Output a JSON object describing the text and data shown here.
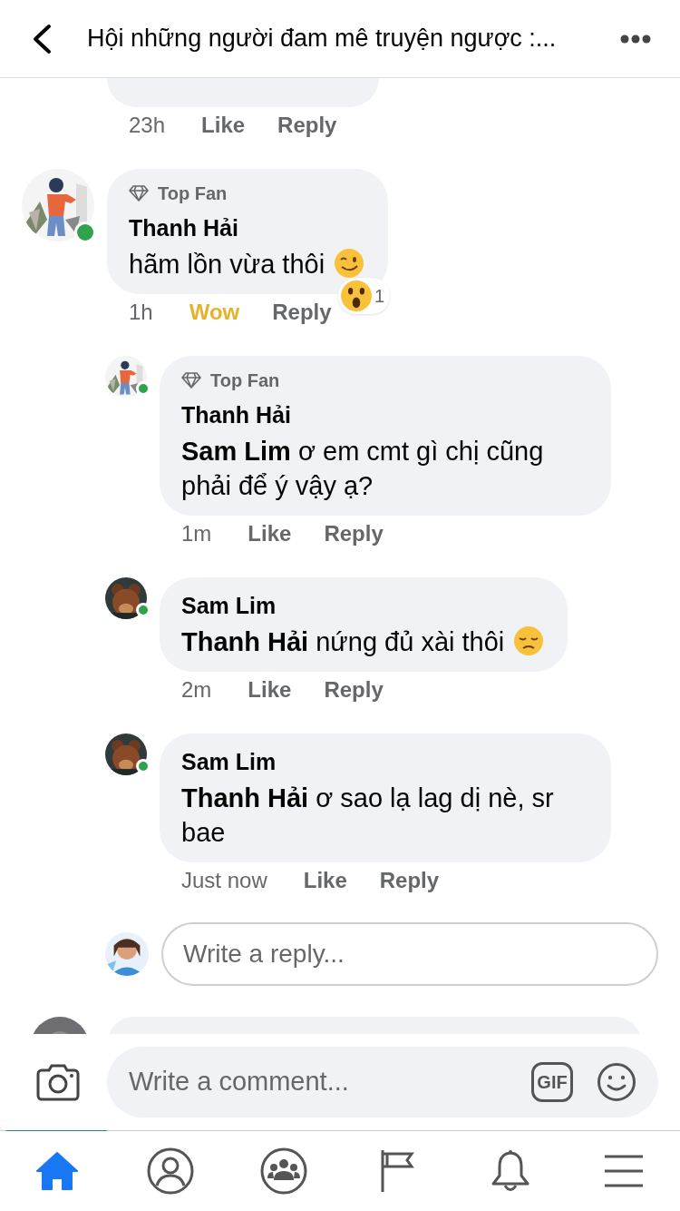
{
  "header": {
    "title": "Hội những người đam mê truyện ngược :..."
  },
  "comments": [
    {
      "kind": "partial",
      "time": "23h",
      "like": "Like",
      "reply": "Reply",
      "reacted": false
    },
    {
      "kind": "comment",
      "avatar": {
        "kind": "girl"
      },
      "online": true,
      "badge": "Top Fan",
      "author": "Thanh Hải",
      "text": "hãm lồn vừa thôi",
      "emoji": {
        "kind": "wink"
      },
      "time": "1h",
      "like": "Wow",
      "reply": "Reply",
      "reacted": true,
      "reaction": {
        "kind": "wow",
        "count": "1"
      },
      "children": [
        {
          "kind": "comment",
          "avatar": {
            "kind": "girl"
          },
          "online": true,
          "badge": "Top Fan",
          "author": "Thanh Hải",
          "text": "**Sam Lim** ơ em cmt gì chị cũng phải để ý vậy ạ?",
          "time": "1m",
          "like": "Like",
          "reply": "Reply",
          "reacted": false
        },
        {
          "kind": "comment",
          "avatar": {
            "kind": "bear"
          },
          "online": true,
          "author": "Sam Lim",
          "text": "**Thanh Hải** nứng đủ xài thôi",
          "emoji": {
            "kind": "sad"
          },
          "time": "2m",
          "like": "Like",
          "reply": "Reply",
          "reacted": false
        },
        {
          "kind": "comment",
          "avatar": {
            "kind": "bear"
          },
          "online": true,
          "author": "Sam Lim",
          "text": "**Thanh Hải** ơ sao lạ lag dị nè, sr bae",
          "time": "Just now",
          "like": "Like",
          "reply": "Reply",
          "reacted": false
        }
      ]
    }
  ],
  "reply_box": {
    "placeholder": "Write a reply..."
  },
  "composer": {
    "placeholder": "Write a comment...",
    "gif": "GIF"
  },
  "nav": [
    {
      "kind": "home",
      "selected": true
    },
    {
      "kind": "profile",
      "selected": false
    },
    {
      "kind": "groups",
      "selected": false
    },
    {
      "kind": "pages",
      "selected": false
    },
    {
      "kind": "notifications",
      "selected": false
    },
    {
      "kind": "menu",
      "selected": false
    }
  ]
}
